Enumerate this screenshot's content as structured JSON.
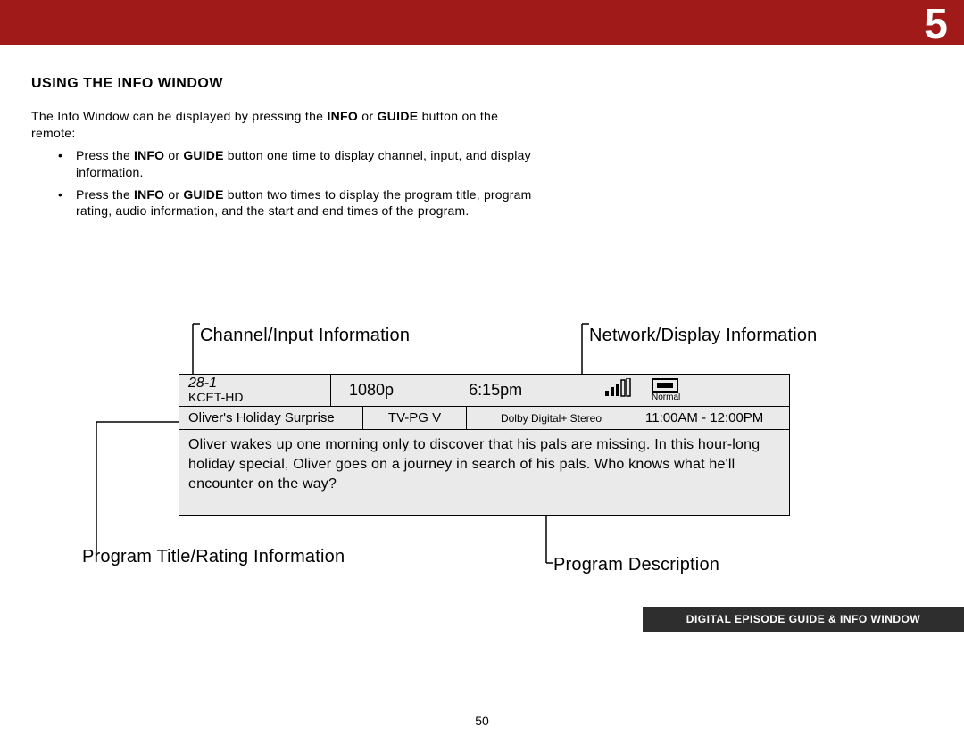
{
  "header": {
    "chapter_number": "5"
  },
  "section": {
    "heading": "USING THE INFO WINDOW",
    "intro_pre": "The Info Window can be displayed by pressing the ",
    "intro_bold1": "INFO",
    "intro_or": " or ",
    "intro_bold2": "GUIDE",
    "intro_post": " button on the remote:",
    "bullet1_pre": "Press the ",
    "bullet1_b1": "INFO",
    "bullet1_mid": " or ",
    "bullet1_b2": "GUIDE",
    "bullet1_post": " button one time to display channel, input, and display information.",
    "bullet2_pre": "Press the ",
    "bullet2_b1": "INFO",
    "bullet2_mid": " or ",
    "bullet2_b2": "GUIDE",
    "bullet2_post": " button two times to display the program title, program rating, audio information, and the start and end times of the program."
  },
  "callouts": {
    "channel": "Channel/Input Information",
    "network": "Network/Display Information",
    "program_title": "Program Title/Rating Information",
    "program_desc": "Program Description"
  },
  "info_window": {
    "channel_number": "28-1",
    "channel_name": "KCET-HD",
    "resolution": "1080p",
    "time": "6:15pm",
    "aspect_mode": "Normal",
    "program_title": "Oliver's Holiday Surprise",
    "rating": "TV-PG V",
    "audio": "Dolby Digital+ Stereo",
    "program_times": "11:00AM - 12:00PM",
    "description": "Oliver wakes up one morning only to discover that his pals are missing. In this hour-long holiday special, Oliver goes on a journey in search of his pals. Who knows what he'll encounter on the way?"
  },
  "footer": {
    "label": "DIGITAL EPISODE GUIDE & INFO WINDOW",
    "page_number": "50"
  }
}
